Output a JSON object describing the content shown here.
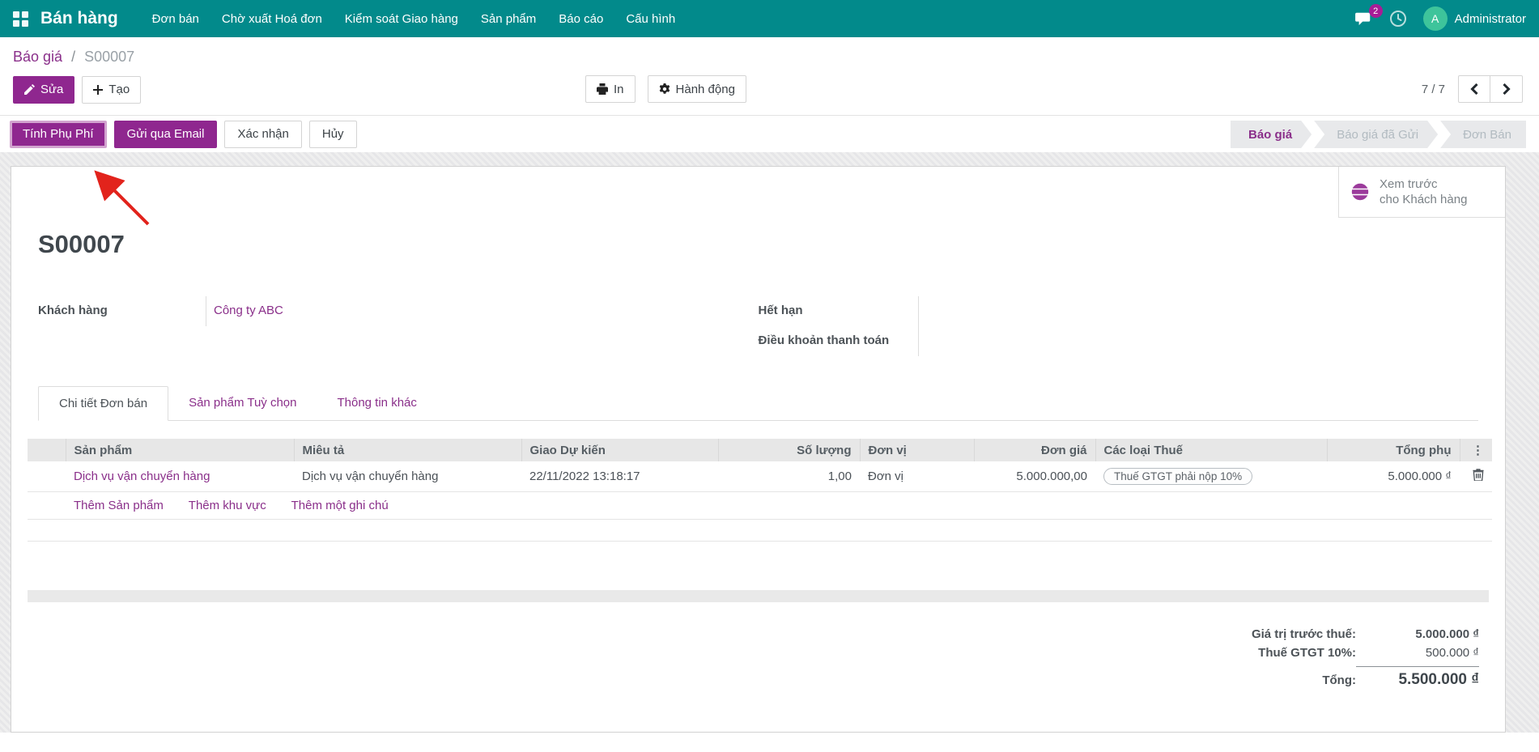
{
  "colors": {
    "teal": "#028a8b",
    "accent": "#8f278f",
    "link": "#8a2f8a",
    "stage-text": "#8a2f8a",
    "badge": "#a81c96",
    "avatar": "#3ec49b",
    "arrow": "#e2231c"
  },
  "nav": {
    "brand": "Bán hàng",
    "items": [
      {
        "label": "Đơn bán"
      },
      {
        "label": "Chờ xuất Hoá đơn"
      },
      {
        "label": "Kiểm soát Giao hàng"
      },
      {
        "label": "Sản phẩm"
      },
      {
        "label": "Báo cáo"
      },
      {
        "label": "Cấu hình"
      }
    ],
    "messages_badge": "2",
    "user": {
      "initial": "A",
      "name": "Administrator"
    }
  },
  "breadcrumb": {
    "parent": "Báo giá",
    "separator": "/",
    "current": "S00007"
  },
  "toolbar": {
    "edit_label": "Sửa",
    "create_label": "Tạo",
    "print_label": "In",
    "action_label": "Hành động",
    "pager_count": "7 / 7"
  },
  "statusbar": {
    "buttons": [
      {
        "label": "Tính Phụ Phí"
      },
      {
        "label": "Gửi qua Email"
      },
      {
        "label": "Xác nhận"
      },
      {
        "label": "Hủy"
      }
    ],
    "stages": [
      {
        "label": "Báo giá"
      },
      {
        "label": "Báo giá đã Gửi"
      },
      {
        "label": "Đơn Bán"
      }
    ]
  },
  "sheet": {
    "preview_button": {
      "line1": "Xem trước",
      "line2": "cho Khách hàng"
    },
    "title": "S00007",
    "fields": {
      "customer_label": "Khách hàng",
      "customer_value": "Công ty ABC",
      "expiry_label": "Hết hạn",
      "expiry_value": "",
      "payment_terms_label": "Điều khoản thanh toán",
      "payment_terms_value": ""
    },
    "tabs": [
      {
        "label": "Chi tiết Đơn bán"
      },
      {
        "label": "Sản phẩm Tuỳ chọn"
      },
      {
        "label": "Thông tin khác"
      }
    ],
    "table": {
      "headers": {
        "product": "Sản phẩm",
        "description": "Miêu tả",
        "delivery": "Giao Dự kiến",
        "quantity": "Số lượng",
        "uom": "Đơn vị",
        "unit_price": "Đơn giá",
        "taxes": "Các loại Thuế",
        "subtotal": "Tổng phụ",
        "options_toggle": "⋮"
      },
      "rows": [
        {
          "product": "Dịch vụ vận chuyển hàng",
          "description": "Dịch vụ vận chuyển hàng",
          "delivery": "22/11/2022 13:18:17",
          "quantity": "1,00",
          "uom": "Đơn vị",
          "unit_price": "5.000.000,00",
          "taxes": "Thuế GTGT phải nộp 10%",
          "subtotal": "5.000.000 ₫"
        }
      ],
      "add_links": [
        {
          "label": "Thêm Sản phẩm"
        },
        {
          "label": "Thêm khu vực"
        },
        {
          "label": "Thêm một ghi chú"
        }
      ]
    },
    "totals": {
      "untaxed_label": "Giá trị trước thuế:",
      "untaxed_value": "5.000.000 ₫",
      "tax_label": "Thuế GTGT 10%:",
      "tax_value": "500.000 ₫",
      "total_label": "Tổng:",
      "total_value": "5.500.000 ₫"
    }
  },
  "icons": {
    "apps": "grid-of-squares",
    "messages": "chat-bubble",
    "activities": "clock",
    "edit": "pencil",
    "create": "plus",
    "print": "printer",
    "action": "gear",
    "pager_prev": "chevron-left",
    "pager_next": "chevron-right",
    "customer_preview": "globe",
    "delete_row": "trash",
    "annotation": "red-arrow"
  }
}
